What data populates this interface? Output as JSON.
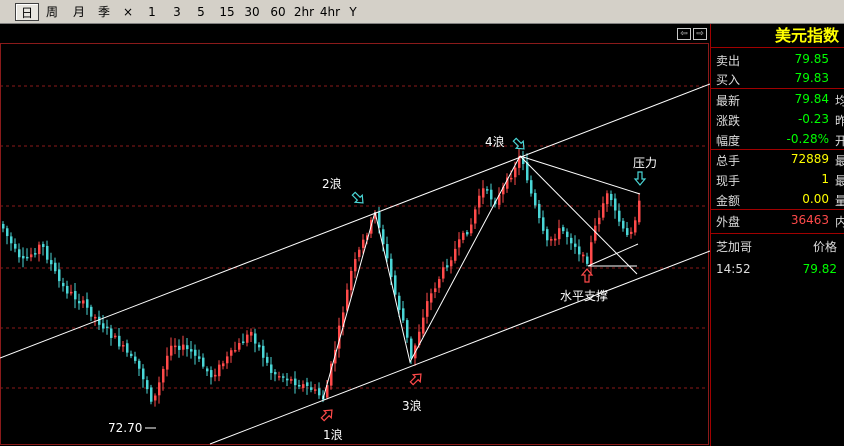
{
  "toolbar": {
    "items": [
      {
        "label": "日",
        "active": true
      },
      {
        "label": "周"
      },
      {
        "label": "月"
      },
      {
        "label": "季"
      },
      {
        "label": "×"
      },
      {
        "label": "1"
      },
      {
        "label": "3"
      },
      {
        "label": "5"
      },
      {
        "label": "15"
      },
      {
        "label": "30"
      },
      {
        "label": "60"
      },
      {
        "label": "2hr"
      },
      {
        "label": "4hr"
      },
      {
        "label": "Y"
      }
    ]
  },
  "chart": {
    "nav_left_icon": "scroll-left-icon",
    "nav_right_icon": "scroll-right-icon",
    "low_price_label": "72.70",
    "annotations": {
      "wave1": "1浪",
      "wave2": "2浪",
      "wave3": "3浪",
      "wave4": "4浪",
      "pressure": "压力",
      "support": "水平支撑"
    },
    "colors": {
      "up_candle": "#ff4a4a",
      "down_candle": "#4ad6d6",
      "grid": "#8a1a1a",
      "trendline": "#ffffff",
      "down_arrow": "#4ad6d6",
      "up_arrow": "#ff4a4a"
    }
  },
  "panel": {
    "title": "美元指数",
    "rows": [
      {
        "label": "卖出",
        "value": "79.85",
        "color": "#00ff00",
        "cut": ""
      },
      {
        "label": "买入",
        "value": "79.83",
        "color": "#00ff00",
        "cut": ""
      },
      {
        "label": "最新",
        "value": "79.84",
        "color": "#00ff00",
        "cut": "均"
      },
      {
        "label": "涨跌",
        "value": "-0.23",
        "color": "#00ff00",
        "cut": "昨"
      },
      {
        "label": "幅度",
        "value": "-0.28%",
        "color": "#00ff00",
        "cut": "开"
      },
      {
        "label": "总手",
        "value": "72889",
        "color": "#ffff00",
        "cut": "最"
      },
      {
        "label": "现手",
        "value": "1",
        "color": "#ffff00",
        "cut": "最"
      },
      {
        "label": "金额",
        "value": "0.00",
        "color": "#ffff00",
        "cut": "量"
      },
      {
        "label": "外盘",
        "value": "36463",
        "color": "#ff4a4a",
        "cut": "内"
      }
    ],
    "ticks_header": {
      "left": "芝加哥",
      "right": "价格"
    },
    "tick": {
      "time": "14:52",
      "price": "79.82",
      "price_color": "#00ff00"
    }
  }
}
